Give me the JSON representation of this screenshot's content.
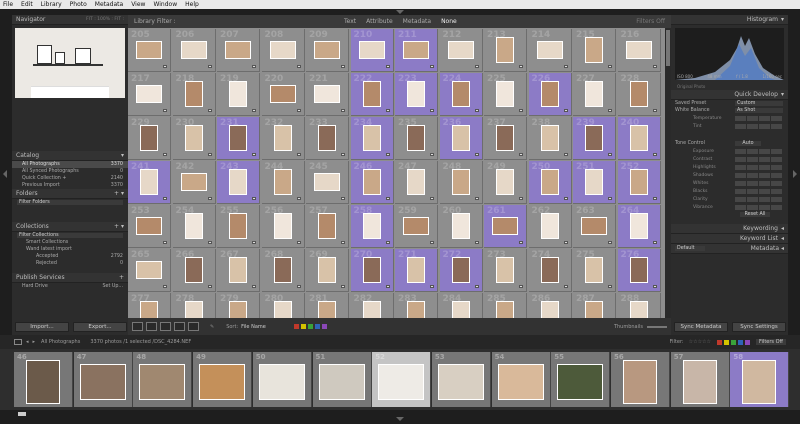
{
  "menu": [
    "File",
    "Edit",
    "Library",
    "Photo",
    "Metadata",
    "View",
    "Window",
    "Help"
  ],
  "navigator": {
    "title": "Navigator",
    "zoom_options": [
      "FIT",
      "100%",
      "FIT",
      "..."
    ]
  },
  "catalog": {
    "title": "Catalog",
    "items": [
      {
        "label": "All Photographs",
        "count": "3370",
        "selected": true
      },
      {
        "label": "All Synced Photographs",
        "count": "0"
      },
      {
        "label": "Quick Collection +",
        "count": "2140"
      },
      {
        "label": "Previous Import",
        "count": "3370"
      }
    ]
  },
  "folders": {
    "title": "Folders",
    "filter_placeholder": "Filter Folders"
  },
  "collections": {
    "title": "Collections",
    "filter_placeholder": "Filter Collections",
    "items": [
      {
        "label": "Smart Collections",
        "count": ""
      },
      {
        "label": "Wand latest import",
        "count": ""
      },
      {
        "label": "Accepted",
        "count": "2792"
      },
      {
        "label": "Rejected",
        "count": "0"
      }
    ]
  },
  "publish": {
    "title": "Publish Services",
    "items": [
      {
        "label": "Hard Drive",
        "count": "Set Up..."
      }
    ]
  },
  "left_buttons": {
    "import": "Import...",
    "export": "Export..."
  },
  "grid": {
    "header_title": "Library Filter :",
    "filters": [
      "Text",
      "Attribute",
      "Metadata",
      "None"
    ],
    "filters_off": "Filters Off",
    "rows": [
      {
        "start": "205",
        "cells": [
          "p",
          "p",
          "p",
          "p",
          "p",
          "v",
          "v",
          "p",
          "p",
          "p",
          "p",
          "p"
        ],
        "shapes": [
          "l",
          "l",
          "l",
          "l",
          "l",
          "l",
          "l",
          "l",
          "p",
          "l",
          "p",
          "l"
        ]
      },
      {
        "start": "217",
        "cells": [
          "p",
          "p",
          "p",
          "p",
          "p",
          "v",
          "v",
          "v",
          "p",
          "v",
          "p",
          "p"
        ],
        "shapes": [
          "l",
          "p",
          "p",
          "l",
          "l",
          "p",
          "p",
          "p",
          "p",
          "p",
          "p",
          "p"
        ]
      },
      {
        "start": "229",
        "cells": [
          "p",
          "p",
          "v",
          "p",
          "p",
          "v",
          "p",
          "v",
          "p",
          "p",
          "v",
          "v"
        ],
        "shapes": [
          "p",
          "p",
          "p",
          "p",
          "p",
          "p",
          "p",
          "p",
          "p",
          "p",
          "p",
          "p"
        ]
      },
      {
        "start": "241",
        "cells": [
          "v",
          "p",
          "v",
          "p",
          "p",
          "v",
          "p",
          "p",
          "p",
          "v",
          "v",
          "v"
        ],
        "shapes": [
          "p",
          "l",
          "p",
          "p",
          "l",
          "p",
          "p",
          "p",
          "p",
          "p",
          "p",
          "p"
        ]
      },
      {
        "start": "253",
        "cells": [
          "p",
          "p",
          "p",
          "p",
          "p",
          "v",
          "p",
          "p",
          "v",
          "p",
          "p",
          "v"
        ],
        "shapes": [
          "l",
          "p",
          "p",
          "p",
          "p",
          "p",
          "l",
          "p",
          "l",
          "p",
          "l",
          "p"
        ]
      },
      {
        "start": "265",
        "cells": [
          "p",
          "p",
          "p",
          "p",
          "p",
          "v",
          "v",
          "v",
          "p",
          "p",
          "p",
          "v"
        ],
        "shapes": [
          "l",
          "p",
          "p",
          "p",
          "p",
          "p",
          "p",
          "p",
          "p",
          "p",
          "p",
          "p"
        ]
      },
      {
        "start": "277",
        "cells": [
          "p",
          "p",
          "p",
          "p",
          "p",
          "p",
          "p",
          "p",
          "p",
          "p",
          "p",
          "p"
        ],
        "shapes": [
          "p",
          "p",
          "p",
          "p",
          "p",
          "p",
          "p",
          "p",
          "p",
          "p",
          "p",
          "p"
        ]
      }
    ]
  },
  "toolbar": {
    "sort_label": "Sort:",
    "sort_value": "File Name",
    "thumbnails_label": "Thumbnails",
    "label_colors": [
      "#c0392b",
      "#d4c300",
      "#3aa33a",
      "#2f63b8",
      "#8b48b8"
    ]
  },
  "histogram": {
    "title": "Histogram",
    "readout": [
      "ISO 800",
      "48 mm",
      "f / 1.8",
      "1/160 sec"
    ],
    "original_label": "Original Photo"
  },
  "quick_develop": {
    "title": "Quick Develop",
    "saved_preset_label": "Saved Preset",
    "saved_preset_value": "Custom",
    "white_balance_label": "White Balance",
    "white_balance_value": "As Shot",
    "temp_label": "Temperature",
    "tint_label": "Tint",
    "tone_control_label": "Tone Control",
    "auto_label": "Auto",
    "sliders": [
      "Exposure",
      "Contrast",
      "Highlights",
      "Shadows",
      "Whites",
      "Blacks",
      "Clarity",
      "Vibrance"
    ],
    "reset_all": "Reset All"
  },
  "keywording": {
    "title": "Keywording"
  },
  "keyword_list": {
    "title": "Keyword List"
  },
  "metadata": {
    "title": "Metadata",
    "preset": "Default"
  },
  "right_buttons": {
    "sync_metadata": "Sync Metadata",
    "sync_settings": "Sync Settings"
  },
  "bottom_bar": {
    "source": "All Photographs",
    "summary": "3370 photos /1 selected /DSC_4284.NEF",
    "filter_label": "Filter:",
    "filters_off": "Filters Off"
  },
  "filmstrip": [
    {
      "num": "46",
      "tone": "#6b5a4a"
    },
    {
      "num": "47",
      "tone": "#8a7260"
    },
    {
      "num": "48",
      "tone": "#a08870"
    },
    {
      "num": "49",
      "tone": "#c4905a"
    },
    {
      "num": "50",
      "tone": "#e8e4dc"
    },
    {
      "num": "51",
      "tone": "#cfc9bf"
    },
    {
      "num": "52",
      "tone": "#eeebe6"
    },
    {
      "num": "53",
      "tone": "#d8cfc2"
    },
    {
      "num": "54",
      "tone": "#d9b99a"
    },
    {
      "num": "55",
      "tone": "#4d5a3a"
    },
    {
      "num": "56",
      "tone": "#b89880"
    },
    {
      "num": "57",
      "tone": "#c8b6a8"
    },
    {
      "num": "58",
      "tone": "#d0b8a0"
    }
  ],
  "colors": {
    "purple": "#8c7bc6",
    "gray": "#8e8e8e",
    "panel": "#2c2c2c",
    "accent_white": "#ffffff"
  }
}
